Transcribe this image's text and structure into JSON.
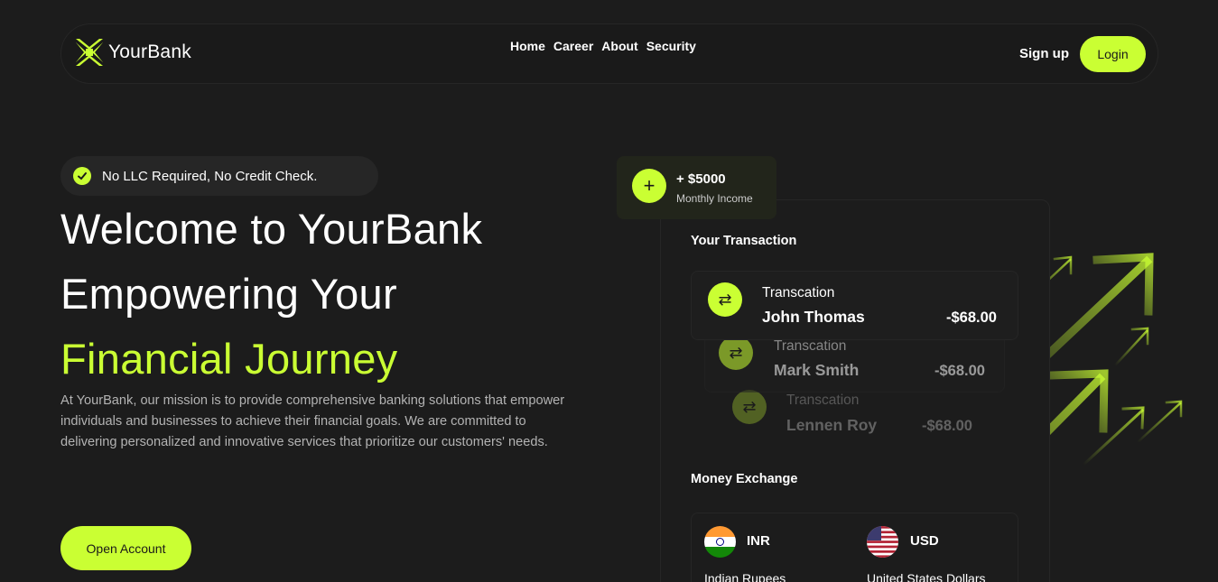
{
  "header": {
    "brand": "YourBank",
    "nav": [
      "Home",
      "Career",
      "About",
      "Security"
    ],
    "signup_label": "Sign up",
    "login_label": "Login"
  },
  "hero": {
    "badge": "No LLC Required, No Credit Check.",
    "line1": "Welcome to YourBank",
    "line2": "Empowering Your",
    "line3": "Financial Journey",
    "description": "At YourBank, our mission is to provide comprehensive banking solutions that empower individuals and businesses to achieve their financial goals. We are committed to delivering personalized and innovative services that prioritize our customers' needs.",
    "cta_label": "Open Account"
  },
  "income": {
    "amount": "+ $5000",
    "label": "Monthly Income"
  },
  "transactions": {
    "title": "Your Transaction",
    "items": [
      {
        "label": "Transcation",
        "name": "John Thomas",
        "amount": "-$68.00"
      },
      {
        "label": "Transcation",
        "name": "Mark Smith",
        "amount": "-$68.00"
      },
      {
        "label": "Transcation",
        "name": "Lennen Roy",
        "amount": "-$68.00"
      }
    ]
  },
  "exchange": {
    "title": "Money Exchange",
    "from": {
      "code": "INR",
      "name": "Indian Rupees"
    },
    "to": {
      "code": "USD",
      "name": "United States Dollars"
    }
  },
  "colors": {
    "accent": "#caff33",
    "background": "#1c1c1c",
    "card": "#262626"
  }
}
